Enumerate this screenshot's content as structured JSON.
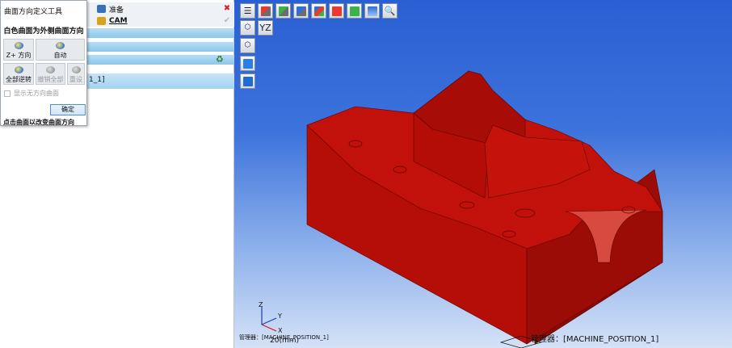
{
  "dialog": {
    "title": "曲面方向定义工具",
    "subtitle": "白色曲面为外侧曲面方向",
    "buttons": {
      "z_plus": "Z+ 方向",
      "auto": "自动",
      "reverse_all": "全部逆转",
      "undo_all": "撤销全部",
      "reset": "重设"
    },
    "show_no_direction": "显示无方向曲面",
    "ok": "确定",
    "hint": "点击曲面以改变曲面方向"
  },
  "tabs": {
    "prep": "准备",
    "cam": "CAM"
  },
  "tree": {
    "node_label": "1_1]"
  },
  "viewport": {
    "status_left": "管理器：[MACHINE_POSITION_1]",
    "status_right": "管理器：[MACHINE_POSITION_1]",
    "scale_label": "20(mm)",
    "axes": {
      "x": "X",
      "y": "Y",
      "z": "Z"
    },
    "yz_label": "YZ"
  },
  "colors": {
    "model_red": "#b30d06",
    "viewport_top": "#2a5fd3",
    "viewport_bottom": "#d5e2f7",
    "band_blue": "#8cc7ec"
  },
  "toolbar": {
    "icons": [
      "menu-icon",
      "cube-view-red-icon",
      "cube-view-green-icon",
      "cube-view-blue-icon",
      "cube-view-solid-icon",
      "cube-view-red-front-icon",
      "cube-view-green-front-icon",
      "layers-icon",
      "zoom-icon"
    ]
  }
}
